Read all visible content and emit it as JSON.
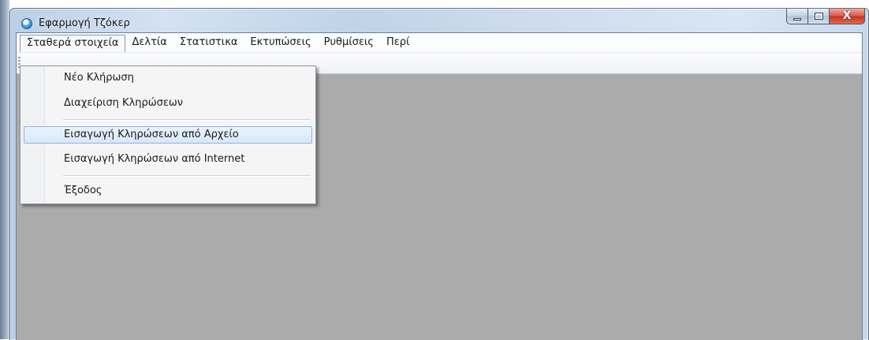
{
  "window": {
    "title": "Εφαρμογή Τζόκερ",
    "close_symbol": "X"
  },
  "menubar": {
    "items": [
      "Σταθερά στοιχεία",
      "Δελτία",
      "Στατιστικα",
      "Εκτυπώσεις",
      "Ρυθμίσεις",
      "Περί"
    ]
  },
  "dropdown": {
    "items": [
      "Νέο Κλήρωση",
      "Διαχείριση Κληρώσεων",
      "Εισαγωγή Κληρώσεων από Αρχείο",
      "Εισαγωγή Κληρώσεων από Internet",
      "Έξοδος"
    ],
    "highlighted": "Εισαγωγή Κληρώσεων από Αρχείο"
  },
  "colors": {
    "workspace": "#ababab",
    "highlight": "#d7e8f8",
    "close_button": "#c4321f"
  },
  "icons": {
    "app": "app-globe-icon",
    "minimize": "minimize-icon",
    "maximize": "maximize-icon",
    "close": "close-icon"
  }
}
